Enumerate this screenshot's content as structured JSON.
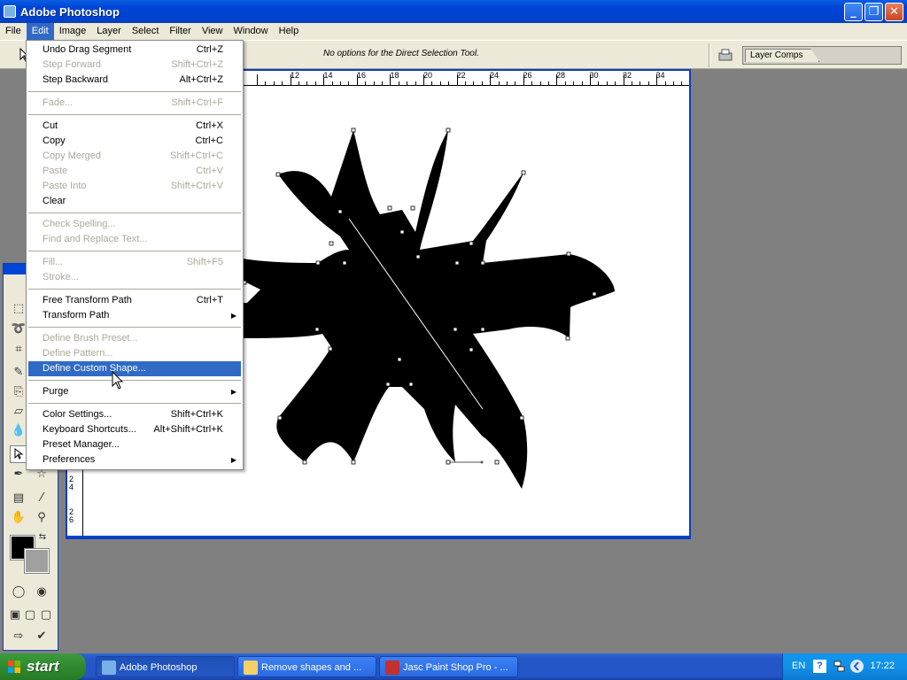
{
  "window": {
    "title": "Adobe Photoshop"
  },
  "menubar": {
    "items": [
      "File",
      "Edit",
      "Image",
      "Layer",
      "Select",
      "Filter",
      "View",
      "Window",
      "Help"
    ],
    "active": "Edit"
  },
  "options_bar": {
    "message": "No options for the Direct Selection Tool.",
    "layer_comps_tab": "Layer Comps"
  },
  "edit_menu": {
    "groups": [
      [
        {
          "label": "Undo Drag Segment",
          "shortcut": "Ctrl+Z",
          "enabled": true
        },
        {
          "label": "Step Forward",
          "shortcut": "Shift+Ctrl+Z",
          "enabled": false
        },
        {
          "label": "Step Backward",
          "shortcut": "Alt+Ctrl+Z",
          "enabled": true
        }
      ],
      [
        {
          "label": "Fade...",
          "shortcut": "Shift+Ctrl+F",
          "enabled": false
        }
      ],
      [
        {
          "label": "Cut",
          "shortcut": "Ctrl+X",
          "enabled": true
        },
        {
          "label": "Copy",
          "shortcut": "Ctrl+C",
          "enabled": true
        },
        {
          "label": "Copy Merged",
          "shortcut": "Shift+Ctrl+C",
          "enabled": false
        },
        {
          "label": "Paste",
          "shortcut": "Ctrl+V",
          "enabled": false
        },
        {
          "label": "Paste Into",
          "shortcut": "Shift+Ctrl+V",
          "enabled": false
        },
        {
          "label": "Clear",
          "shortcut": "",
          "enabled": true
        }
      ],
      [
        {
          "label": "Check Spelling...",
          "shortcut": "",
          "enabled": false
        },
        {
          "label": "Find and Replace Text...",
          "shortcut": "",
          "enabled": false
        }
      ],
      [
        {
          "label": "Fill...",
          "shortcut": "Shift+F5",
          "enabled": false
        },
        {
          "label": "Stroke...",
          "shortcut": "",
          "enabled": false
        }
      ],
      [
        {
          "label": "Free Transform Path",
          "shortcut": "Ctrl+T",
          "enabled": true
        },
        {
          "label": "Transform Path",
          "shortcut": "",
          "enabled": true,
          "submenu": true
        }
      ],
      [
        {
          "label": "Define Brush Preset...",
          "shortcut": "",
          "enabled": false
        },
        {
          "label": "Define Pattern...",
          "shortcut": "",
          "enabled": false
        },
        {
          "label": "Define Custom Shape...",
          "shortcut": "",
          "enabled": true,
          "highlighted": true
        }
      ],
      [
        {
          "label": "Purge",
          "shortcut": "",
          "enabled": true,
          "submenu": true
        }
      ],
      [
        {
          "label": "Color Settings...",
          "shortcut": "Shift+Ctrl+K",
          "enabled": true
        },
        {
          "label": "Keyboard Shortcuts...",
          "shortcut": "Alt+Shift+Ctrl+K",
          "enabled": true
        },
        {
          "label": "Preset Manager...",
          "shortcut": "",
          "enabled": true
        },
        {
          "label": "Preferences",
          "shortcut": "",
          "enabled": true,
          "submenu": true
        }
      ]
    ]
  },
  "rulers": {
    "top_labels": [
      "12",
      "14",
      "16",
      "18",
      "20",
      "22",
      "24",
      "26",
      "28",
      "30",
      "32",
      "34"
    ],
    "left_labels": [
      "24",
      "26"
    ]
  },
  "colors": {
    "foreground": "#000000",
    "background": "#a0a0a0",
    "menu_highlight": "#316ac5",
    "xp_blue": "#0045d6"
  },
  "taskbar": {
    "start_label": "start",
    "tasks": [
      {
        "label": "Adobe Photoshop",
        "icon": "photoshop-icon",
        "active": true
      },
      {
        "label": "Remove shapes and ...",
        "icon": "folder-icon",
        "active": false
      },
      {
        "label": "Jasc Paint Shop Pro - ...",
        "icon": "paintshop-icon",
        "active": false
      }
    ],
    "tray": {
      "language": "EN",
      "clock": "17:22"
    }
  }
}
